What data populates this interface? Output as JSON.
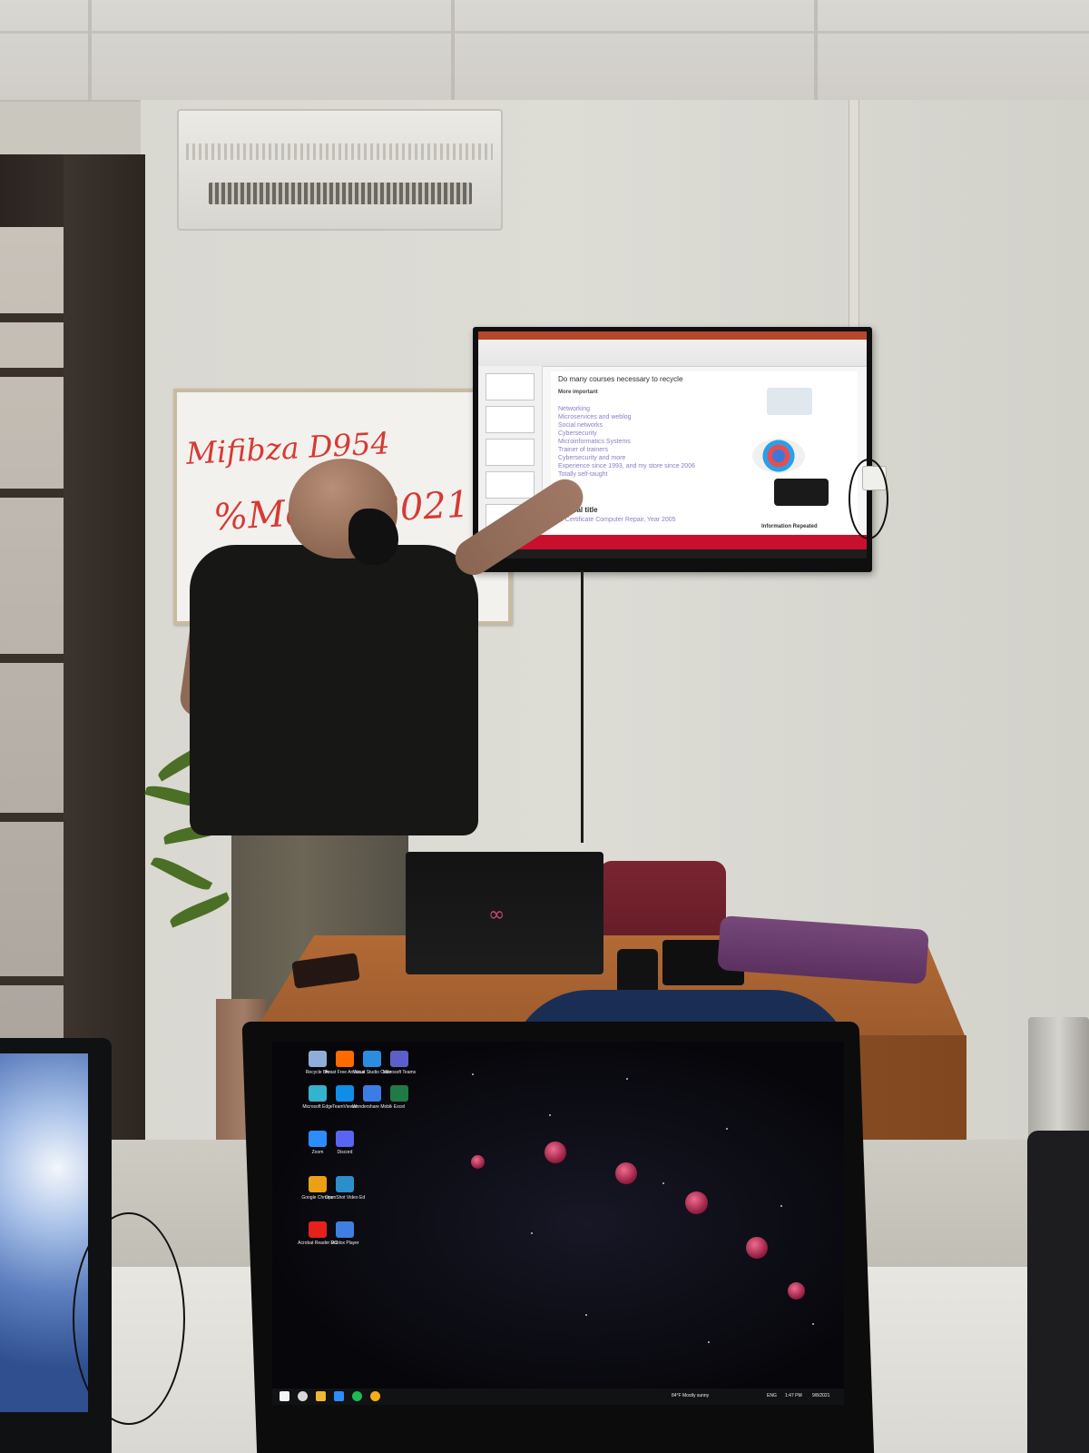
{
  "whiteboard": {
    "line1": "Mifibza D954",
    "line2": "%Mer  ds2021"
  },
  "tv_slide": {
    "title": "Do many courses necessary to recycle",
    "subtitle": "More important",
    "items": [
      "Networking",
      "Microservices and weblog",
      "Social networks",
      "Cybersecurity",
      "Microinformatics Systems",
      "Trainer of trainers",
      "Cybersecurity and more",
      "Experience since 1993, and my store since 2006",
      "Totally self-taught"
    ],
    "footer_title": "Official title",
    "footer_line": "... Certificate Computer Repair, Year 2005",
    "footer_right": "Information Repeated"
  },
  "desktop": {
    "icons": [
      {
        "label": "Recycle Bin",
        "color": "#8eaed8"
      },
      {
        "label": "Avast Free Antivirus",
        "color": "#ff6a00"
      },
      {
        "label": "Visual Studio Code",
        "color": "#2b8de0"
      },
      {
        "label": "Microsoft Teams",
        "color": "#5b5fc7"
      },
      {
        "label": "Microsoft Edge",
        "color": "#34b3ce"
      },
      {
        "label": "TeamViewer",
        "color": "#0e8ee9"
      },
      {
        "label": "Wondershare MobileTrans",
        "color": "#3a7de5"
      },
      {
        "label": "Excel",
        "color": "#1f7a45"
      },
      {
        "label": "Zoom",
        "color": "#2d8cff"
      },
      {
        "label": "Discord",
        "color": "#5865f2"
      },
      {
        "label": "Google Chrome",
        "color": "#eaa116"
      },
      {
        "label": "OpenShot Video Editor",
        "color": "#2c8ecb"
      },
      {
        "label": "Acrobat Reader DC",
        "color": "#e6211b"
      },
      {
        "label": "Roblox Player",
        "color": "#3f7fe2"
      }
    ],
    "taskbar": {
      "weather": "84°F Mostly sunny",
      "time": "1:47 PM",
      "date": "9/8/2021",
      "lang": "ENG"
    }
  },
  "colors": {
    "tv_taskbar": "#c8102e",
    "moon": "#d8375f",
    "desk": "#a9612f",
    "case": "#6a3d6d"
  }
}
